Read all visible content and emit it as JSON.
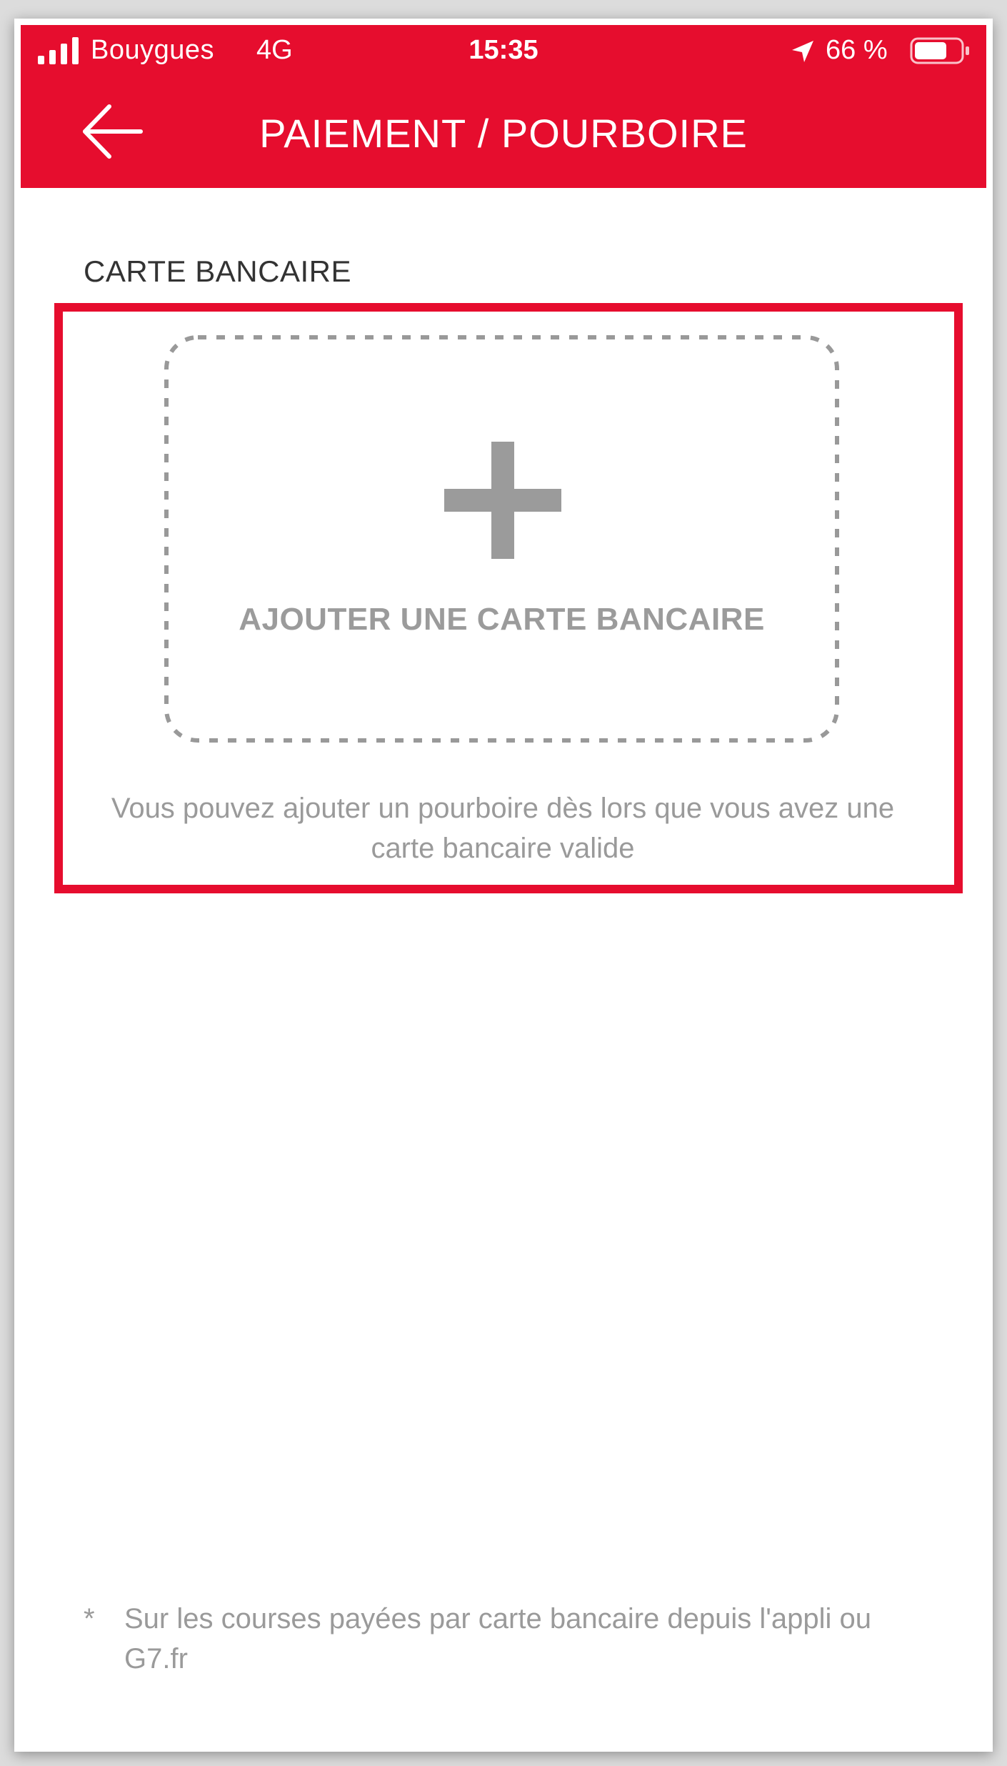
{
  "status_bar": {
    "carrier": "Bouygues",
    "network": "4G",
    "time": "15:35",
    "battery": "66 %",
    "icons": [
      "signal-icon",
      "location-icon",
      "battery-icon"
    ]
  },
  "header": {
    "title": "PAIEMENT / POURBOIRE",
    "back_icon": "back-arrow-icon",
    "color": "#e60d2e"
  },
  "section": {
    "title": "CARTE BANCAIRE"
  },
  "add_card": {
    "icon": "plus-icon",
    "label": "AJOUTER UNE CARTE BANCAIRE"
  },
  "tip_info": "Vous pouvez ajouter un pourboire dès lors que vous avez une carte bancaire valide",
  "footnote": {
    "marker": "*",
    "text": "Sur les courses payées par carte bancaire depuis l'appli ou G7.fr"
  },
  "colors": {
    "brand_red": "#e60d2e",
    "muted_text": "#9a9a9a",
    "plus_gray": "#9b9b9b"
  }
}
